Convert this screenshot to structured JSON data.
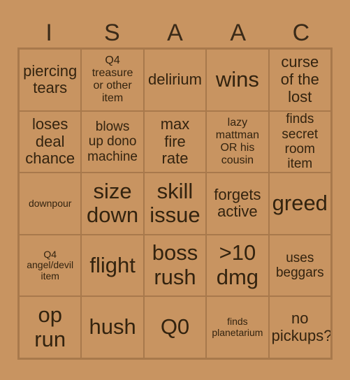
{
  "card": {
    "header_letters": [
      "I",
      "S",
      "A",
      "A",
      "C"
    ],
    "colors": {
      "background": "#c89461",
      "cell_background": "#c89461",
      "border": "#a8794c",
      "text": "#33230f",
      "header_text": "#3a2a18"
    },
    "rows": [
      [
        {
          "text": "piercing\ntears",
          "size": "fs-lg"
        },
        {
          "text": "Q4\ntreasure\nor other\nitem",
          "size": "fs-sm"
        },
        {
          "text": "delirium",
          "size": "fs-lg"
        },
        {
          "text": "wins",
          "size": "fs-xxl"
        },
        {
          "text": "curse\nof the\nlost",
          "size": "fs-lg"
        }
      ],
      [
        {
          "text": "loses\ndeal\nchance",
          "size": "fs-lg"
        },
        {
          "text": "blows\nup dono\nmachine",
          "size": "fs-md"
        },
        {
          "text": "max\nfire\nrate",
          "size": "fs-lg"
        },
        {
          "text": "lazy\nmattman\nOR his\ncousin",
          "size": "fs-sm"
        },
        {
          "text": "finds\nsecret\nroom item",
          "size": "fs-md"
        }
      ],
      [
        {
          "text": "downpour",
          "size": "fs-xs"
        },
        {
          "text": "size\ndown",
          "size": "fs-xxl"
        },
        {
          "text": "skill\nissue",
          "size": "fs-xxl"
        },
        {
          "text": "forgets\nactive",
          "size": "fs-lg"
        },
        {
          "text": "greed",
          "size": "fs-xxl"
        }
      ],
      [
        {
          "text": "Q4\nangel/devil\nitem",
          "size": "fs-xs"
        },
        {
          "text": "flight",
          "size": "fs-xxl"
        },
        {
          "text": "boss\nrush",
          "size": "fs-xxl"
        },
        {
          "text": ">10\ndmg",
          "size": "fs-xxl"
        },
        {
          "text": "uses\nbeggars",
          "size": "fs-md"
        }
      ],
      [
        {
          "text": "op\nrun",
          "size": "fs-xxl"
        },
        {
          "text": "hush",
          "size": "fs-xxl"
        },
        {
          "text": "Q0",
          "size": "fs-xxl"
        },
        {
          "text": "finds\nplanetarium",
          "size": "fs-xs"
        },
        {
          "text": "no\npickups?",
          "size": "fs-lg"
        }
      ]
    ]
  }
}
